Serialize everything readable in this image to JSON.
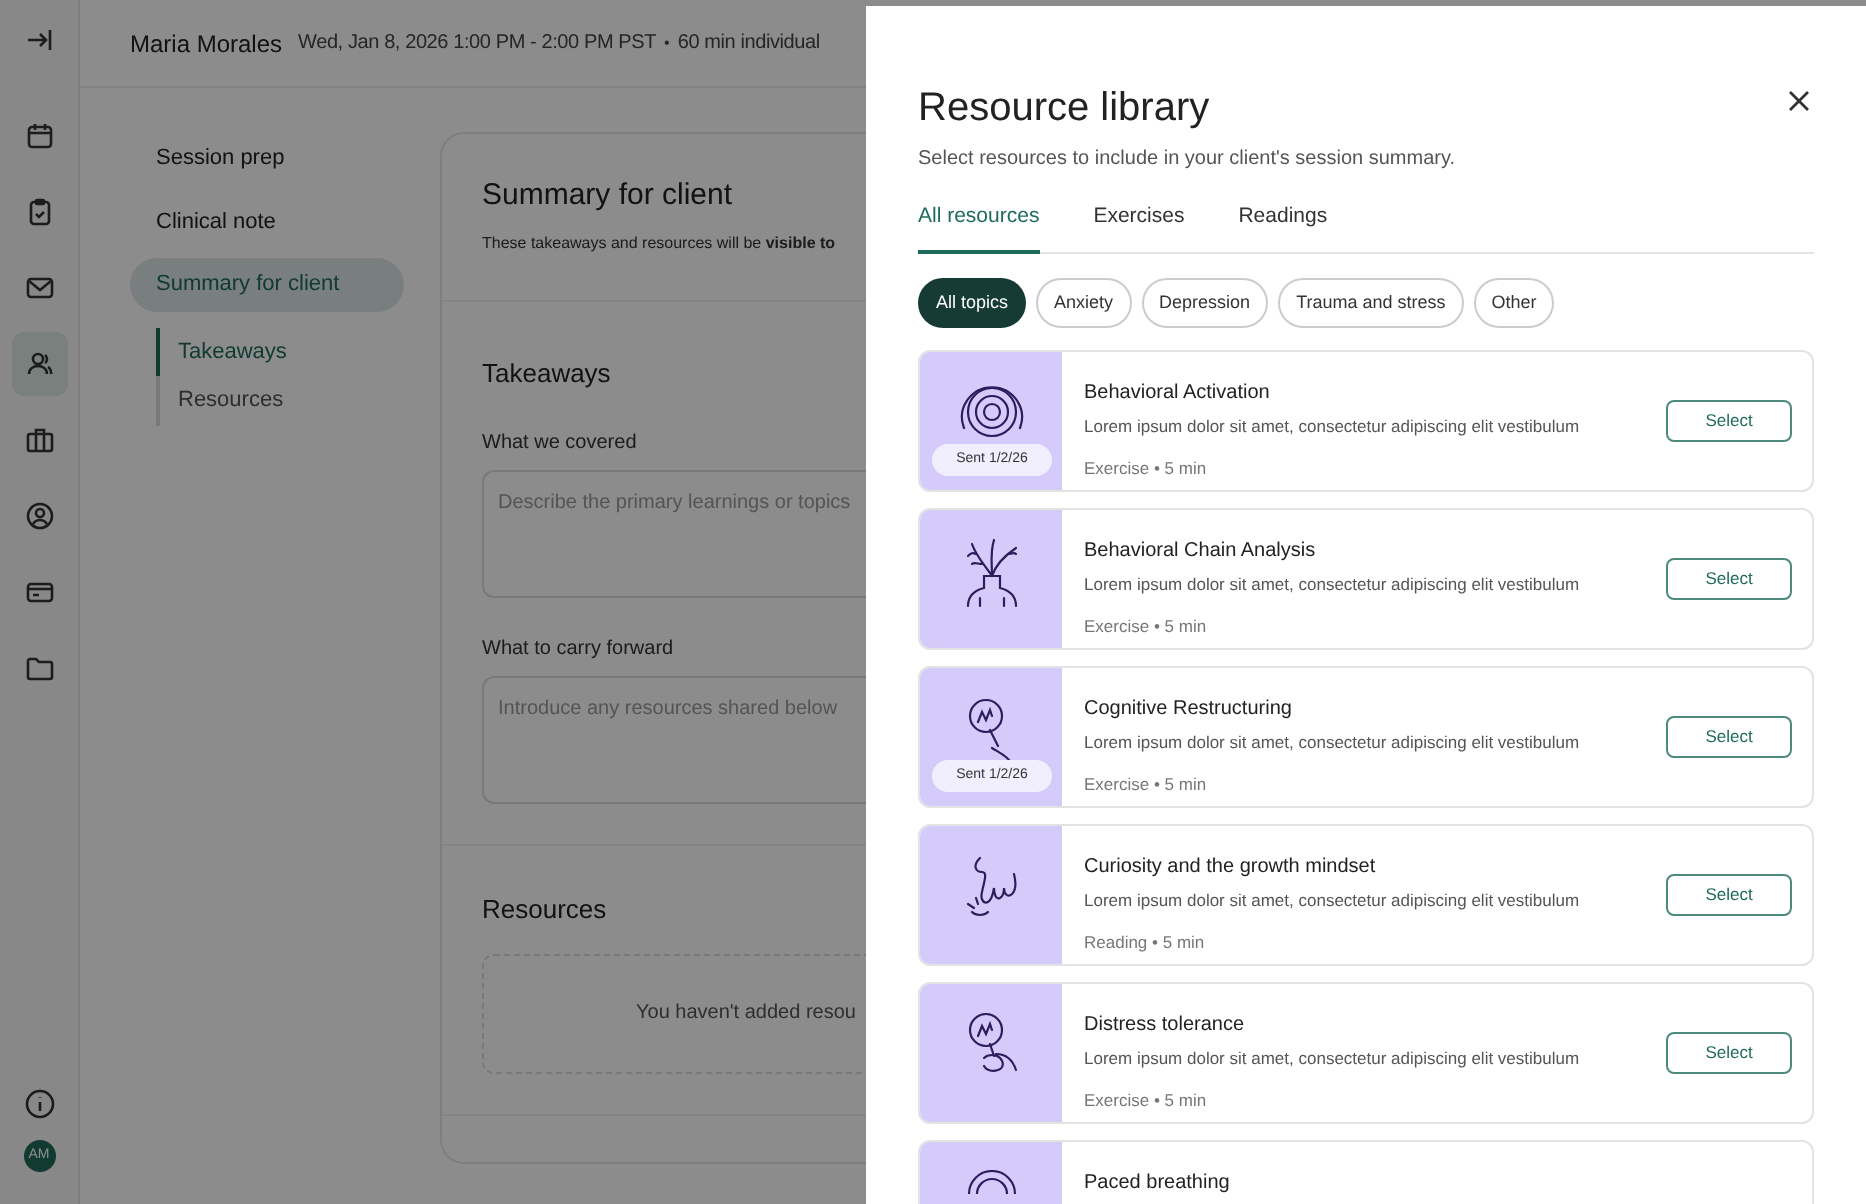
{
  "header": {
    "client_name": "Maria Morales",
    "datetime": "Wed, Jan 8, 2026 1:00 PM - 2:00 PM PST",
    "separator": "•",
    "session_type": "60 min individual"
  },
  "rail": {
    "items": [
      {
        "selected": false
      },
      {
        "selected": false
      },
      {
        "selected": false
      },
      {
        "selected": true
      },
      {
        "selected": false
      },
      {
        "selected": false
      },
      {
        "selected": false
      },
      {
        "selected": false
      }
    ],
    "avatar": "AM"
  },
  "nav": {
    "items": [
      {
        "label": "Session prep",
        "selected": false
      },
      {
        "label": "Clinical note",
        "selected": false
      },
      {
        "label": "Summary for client",
        "selected": true
      }
    ],
    "subitems": [
      {
        "label": "Takeaways",
        "selected": true
      },
      {
        "label": "Resources",
        "selected": false
      }
    ]
  },
  "summary_card": {
    "title": "Summary for client",
    "subtitle": "These takeaways and resources will be **visible to**",
    "takeaways": {
      "heading": "Takeaways",
      "fields": [
        {
          "label": "What we covered",
          "placeholder": "Describe the primary learnings or topics"
        },
        {
          "label": "What to carry forward",
          "placeholder": "Introduce any resources shared below"
        }
      ]
    },
    "resources": {
      "heading": "Resources",
      "empty_text": "You haven't added resou"
    }
  },
  "drawer": {
    "title": "Resource library",
    "subtitle": "Select resources to include in your client's session summary.",
    "tabs": [
      {
        "label": "All resources",
        "selected": true
      },
      {
        "label": "Exercises",
        "selected": false
      },
      {
        "label": "Readings",
        "selected": false
      }
    ],
    "topics": [
      {
        "label": "All topics",
        "selected": true
      },
      {
        "label": "Anxiety",
        "selected": false
      },
      {
        "label": "Depression",
        "selected": false
      },
      {
        "label": "Trauma and stress",
        "selected": false
      },
      {
        "label": "Other",
        "selected": false
      }
    ],
    "resources": [
      {
        "title": "Behavioral Activation",
        "description": "Lorem ipsum dolor sit amet, consectetur adipiscing elit vestibulum",
        "meta": "Exercise • 5 min",
        "button": "Select",
        "sent_badge": "Sent 1/2/26"
      },
      {
        "title": "Behavioral Chain Analysis",
        "description": "Lorem ipsum dolor sit amet, consectetur adipiscing elit vestibulum",
        "meta": "Exercise • 5 min",
        "button": "Select"
      },
      {
        "title": "Cognitive Restructuring",
        "description": "Lorem ipsum dolor sit amet, consectetur adipiscing elit vestibulum",
        "meta": "Exercise • 5 min",
        "button": "Select",
        "sent_badge": "Sent 1/2/26"
      },
      {
        "title": "Curiosity and the growth mindset",
        "description": "Lorem ipsum dolor sit amet, consectetur adipiscing elit vestibulum",
        "meta": "Reading • 5 min",
        "button": "Select"
      },
      {
        "title": "Distress tolerance",
        "description": "Lorem ipsum dolor sit amet, consectetur adipiscing elit vestibulum",
        "meta": "Exercise • 5 min",
        "button": "Select"
      },
      {
        "title": "Paced breathing"
      }
    ]
  }
}
